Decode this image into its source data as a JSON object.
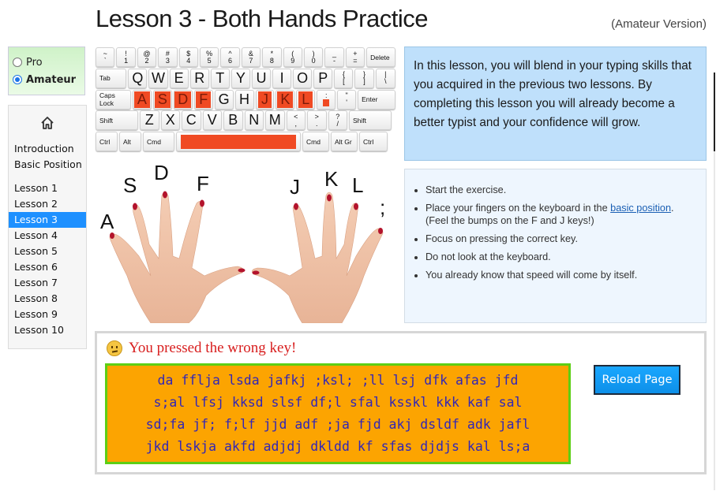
{
  "header": {
    "title": "Lesson 3 - Both Hands Practice",
    "version": "(Amateur Version)"
  },
  "mode": {
    "options": [
      {
        "label": "Pro",
        "checked": false
      },
      {
        "label": "Amateur",
        "checked": true
      }
    ]
  },
  "nav": {
    "home_icon": "home-icon",
    "top_links": [
      "Introduction",
      "Basic Position"
    ],
    "lessons": [
      "Lesson 1",
      "Lesson 2",
      "Lesson 3",
      "Lesson 4",
      "Lesson 5",
      "Lesson 6",
      "Lesson 7",
      "Lesson 8",
      "Lesson 9",
      "Lesson 10"
    ],
    "active": "Lesson 3"
  },
  "keyboard": {
    "highlight_color": "#f04a23",
    "row1": [
      [
        "~",
        "`"
      ],
      [
        "!",
        "1"
      ],
      [
        "@",
        "2"
      ],
      [
        "#",
        "3"
      ],
      [
        "$",
        "4"
      ],
      [
        "%",
        "5"
      ],
      [
        "^",
        "6"
      ],
      [
        "&",
        "7"
      ],
      [
        "*",
        "8"
      ],
      [
        "(",
        "9"
      ],
      [
        ")",
        "0"
      ],
      [
        "_",
        "-"
      ],
      [
        "+",
        "="
      ]
    ],
    "row1_end": "Delete",
    "row2_start": "Tab",
    "row2": [
      "Q",
      "W",
      "E",
      "R",
      "T",
      "Y",
      "U",
      "I",
      "O",
      "P"
    ],
    "row2_end": [
      [
        "{",
        "["
      ],
      [
        "}",
        "]"
      ],
      [
        "|",
        "\\"
      ]
    ],
    "row3_start": "Caps Lock",
    "row3": [
      {
        "k": "A",
        "hl": true
      },
      {
        "k": "S",
        "hl": true
      },
      {
        "k": "D",
        "hl": true
      },
      {
        "k": "F",
        "hl": true
      },
      {
        "k": "G",
        "hl": false
      },
      {
        "k": "H",
        "hl": false
      },
      {
        "k": "J",
        "hl": true
      },
      {
        "k": "K",
        "hl": true
      },
      {
        "k": "L",
        "hl": true
      }
    ],
    "row3_semicolon": [
      ":",
      ";"
    ],
    "row3_quote": [
      "\"",
      "'"
    ],
    "row3_end": "Enter",
    "row4_start": "Shift",
    "row4": [
      "Z",
      "X",
      "C",
      "V",
      "B",
      "N",
      "M"
    ],
    "row4_punct": [
      [
        "<",
        ","
      ],
      [
        ">",
        "."
      ],
      [
        "?",
        "/"
      ]
    ],
    "row4_end": "Shift",
    "row5_left": [
      "Ctrl",
      "Alt",
      "Cmd"
    ],
    "row5_right": [
      "Cmd",
      "Alt Gr",
      "Ctrl"
    ]
  },
  "hands": {
    "left_labels": [
      "A",
      "S",
      "D",
      "F"
    ],
    "right_labels": [
      "J",
      "K",
      "L",
      ";"
    ]
  },
  "intro_text": "In this lesson, you will blend in your typing skills that you acquired in the previous two lessons. By completing this lesson you will already become a better typist and your confidence will grow.",
  "tips": {
    "items": [
      "Start the exercise.",
      "Place your fingers on the keyboard in the ",
      "Focus on pressing the correct key.",
      "Do not look at the keyboard.",
      "You already know that speed will come by itself."
    ],
    "link_text": "basic position",
    "after_link": ". (Feel the bumps on the F and J keys!)"
  },
  "exercise": {
    "status": "You pressed the wrong key!",
    "status_icon": "confused-face-icon",
    "lines": [
      "da fflja lsda jafkj ;ksl; ;ll lsj dfk afas jfd",
      "s;al lfsj kksd slsf df;l sfal ksskl kkk kaf sal",
      "sd;fa jf; f;lf jjd adf ;ja fjd akj dsldf adk jafl",
      "jkd lskja akfd adjdj dkldd kf sfas djdjs kal ls;a"
    ],
    "reload_label": "Reload Page"
  }
}
